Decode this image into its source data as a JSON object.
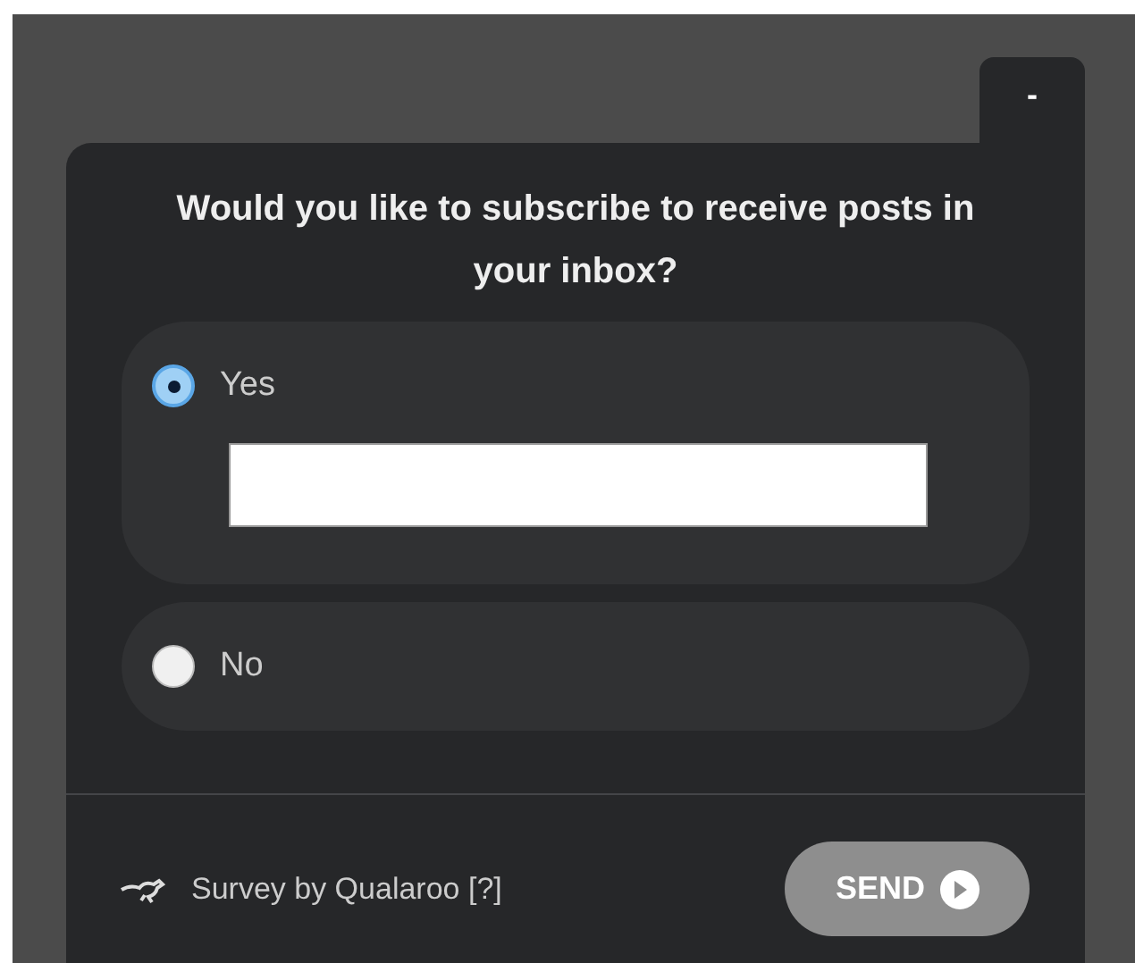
{
  "minimize_button": "-",
  "question": "Would you like to subscribe to receive posts in your inbox?",
  "options": [
    {
      "label": "Yes",
      "selected": true,
      "kind": "text"
    },
    {
      "label": "No",
      "selected": false,
      "kind": "plain"
    }
  ],
  "footer": {
    "credit": "Survey by Qualaroo [?]",
    "send_button": "SEND"
  }
}
